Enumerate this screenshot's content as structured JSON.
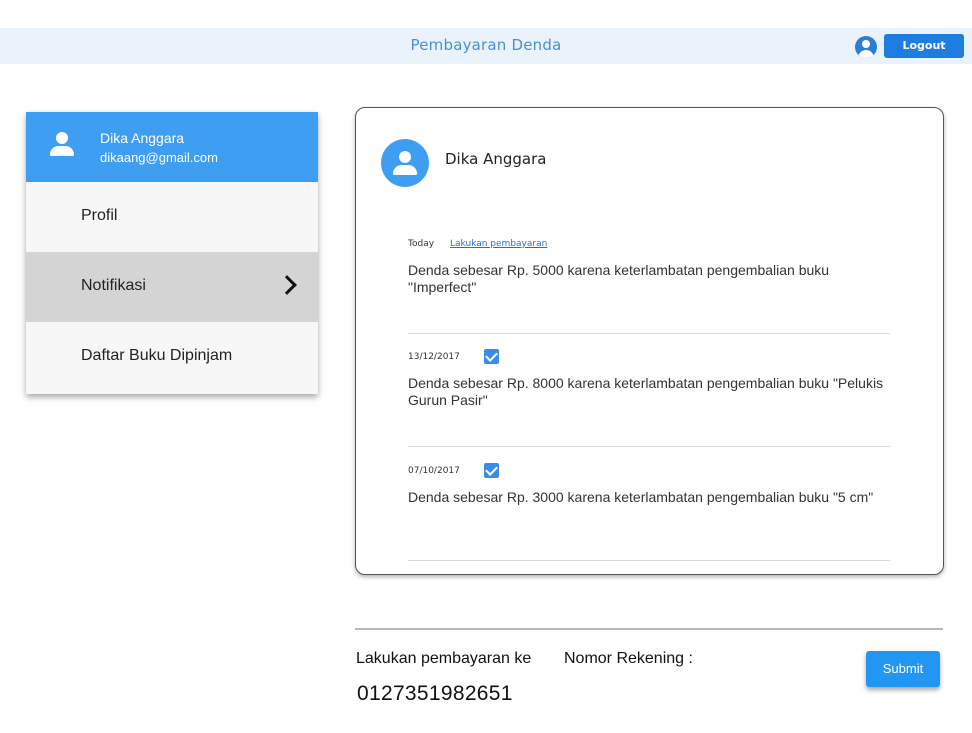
{
  "header": {
    "title": "Pembayaran Denda",
    "logout_label": "Logout",
    "user_icon": "user-circle-icon"
  },
  "sidebar": {
    "user": {
      "name": "Dika Anggara",
      "email": "dikaang@gmail.com",
      "icon": "person-icon"
    },
    "items": [
      {
        "label": "Profil",
        "active": false
      },
      {
        "label": "Notifikasi",
        "active": true,
        "icon": "chevron-right-icon"
      },
      {
        "label": "Daftar Buku Dipinjam",
        "active": false
      }
    ]
  },
  "card": {
    "name": "Dika Anggara",
    "notifications": [
      {
        "date": "Today",
        "action": "Lakukan pembayaran",
        "checked": false,
        "message": "Denda sebesar Rp. 5000 karena keterlambatan pengembalian buku \"Imperfect\""
      },
      {
        "date": "13/12/2017",
        "checked": true,
        "message": "Denda sebesar Rp. 8000 karena keterlambatan pengembalian buku \"Pelukis Gurun Pasir\""
      },
      {
        "date": "07/10/2017",
        "checked": true,
        "message": "Denda sebesar Rp. 3000 karena keterlambatan pengembalian buku \"5 cm\""
      }
    ]
  },
  "payment": {
    "label": "Lakukan pembayaran ke",
    "account_label": "Nomor Rekening :",
    "account_number": "0127351982651",
    "submit_label": "Submit"
  },
  "colors": {
    "accent": "#3e9ef2",
    "header_bg": "#eaf3fc",
    "button": "#2196f3"
  }
}
